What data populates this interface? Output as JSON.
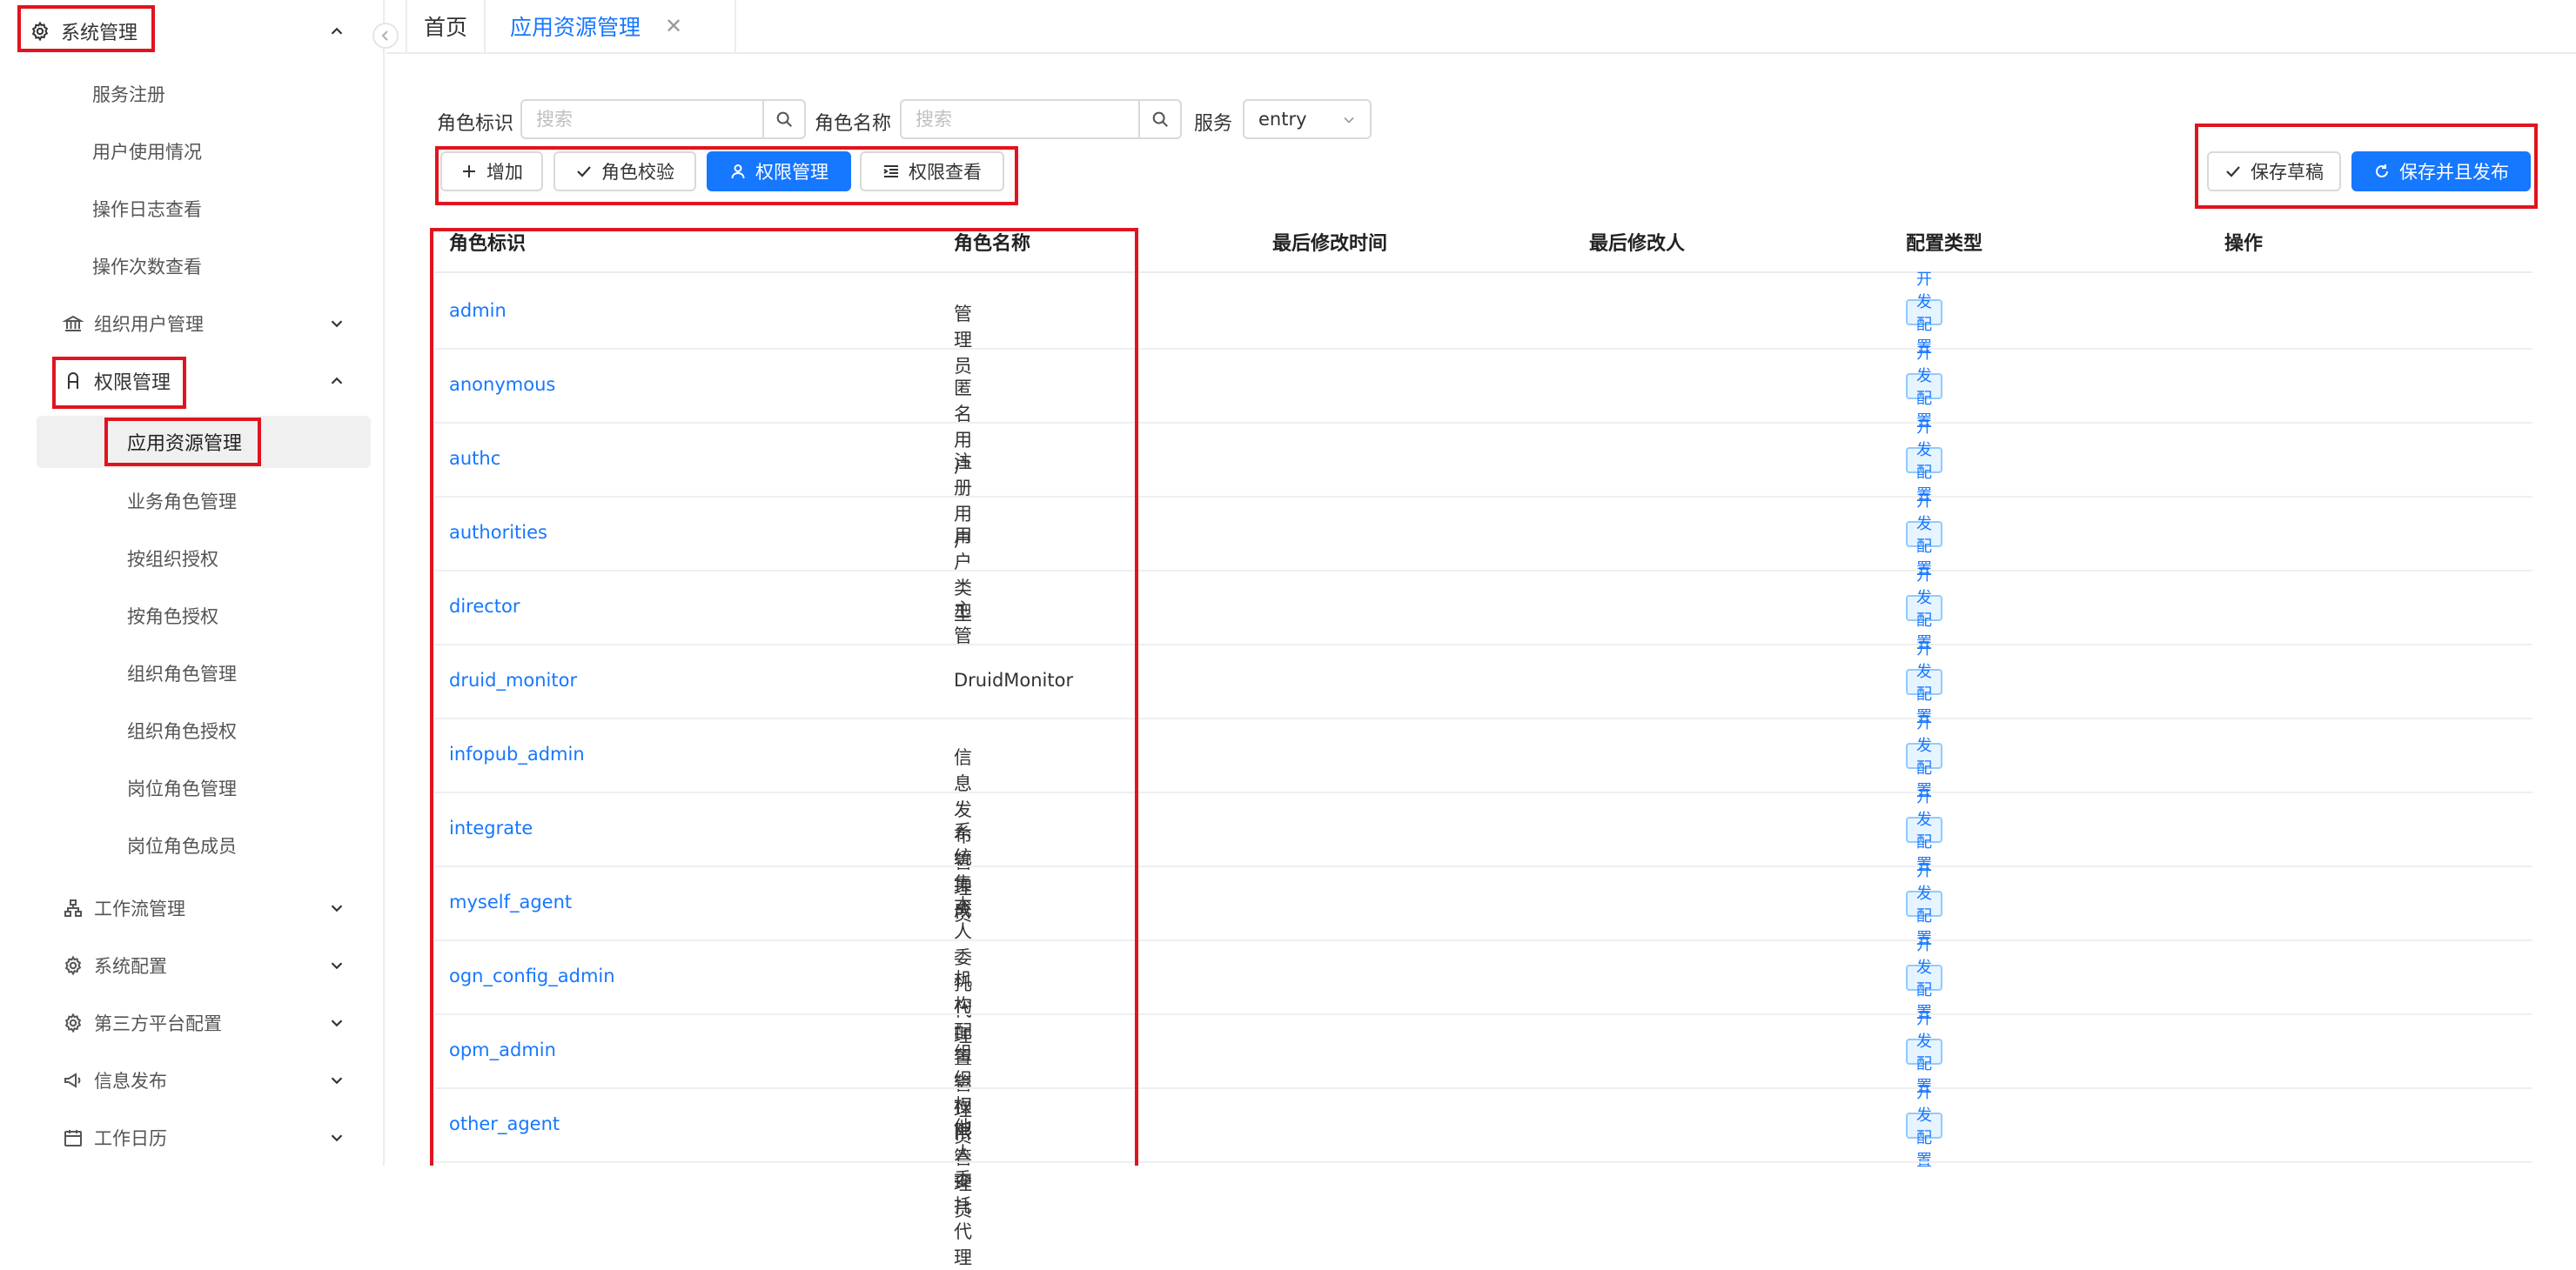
{
  "sidebar": {
    "items": [
      {
        "label": "系统管理",
        "icon": "gear-icon",
        "expanded": true
      },
      {
        "label": "服务注册"
      },
      {
        "label": "用户使用情况"
      },
      {
        "label": "操作日志查看"
      },
      {
        "label": "操作次数查看"
      },
      {
        "label": "组织用户管理",
        "icon": "bank-icon",
        "expanded": false
      },
      {
        "label": "权限管理",
        "icon": "user-lock-icon",
        "expanded": true
      },
      {
        "label": "应用资源管理",
        "active": true
      },
      {
        "label": "业务角色管理"
      },
      {
        "label": "按组织授权"
      },
      {
        "label": "按角色授权"
      },
      {
        "label": "组织角色管理"
      },
      {
        "label": "组织角色授权"
      },
      {
        "label": "岗位角色管理"
      },
      {
        "label": "岗位角色成员"
      },
      {
        "label": "工作流管理",
        "icon": "workflow-icon",
        "expanded": false
      },
      {
        "label": "系统配置",
        "icon": "gear-icon",
        "expanded": false
      },
      {
        "label": "第三方平台配置",
        "icon": "gear-icon",
        "expanded": false
      },
      {
        "label": "信息发布",
        "icon": "megaphone-icon",
        "expanded": false
      },
      {
        "label": "工作日历",
        "icon": "calendar-icon",
        "expanded": false
      }
    ]
  },
  "tabs": {
    "home": "首页",
    "active": "应用资源管理",
    "close": "✕"
  },
  "filters": {
    "role_id_label": "角色标识",
    "role_id_placeholder": "搜索",
    "role_name_label": "角色名称",
    "role_name_placeholder": "搜索",
    "service_label": "服务",
    "service_value": "entry"
  },
  "toolbar": {
    "add": "增加",
    "verify": "角色校验",
    "permission_manage": "权限管理",
    "permission_view": "权限查看",
    "save_draft": "保存草稿",
    "save_publish": "保存并且发布"
  },
  "table": {
    "columns": [
      "角色标识",
      "角色名称",
      "最后修改时间",
      "最后修改人",
      "配置类型",
      "操作"
    ],
    "rows": [
      {
        "id": "admin",
        "name": "管理员",
        "type": "开发配置"
      },
      {
        "id": "anonymous",
        "name": "匿名用户",
        "type": "开发配置"
      },
      {
        "id": "authc",
        "name": "注册用户",
        "type": "开发配置"
      },
      {
        "id": "authorities",
        "name": "用户类型",
        "type": "开发配置"
      },
      {
        "id": "director",
        "name": "主管",
        "type": "开发配置"
      },
      {
        "id": "druid_monitor",
        "name": "DruidMonitor",
        "type": "开发配置"
      },
      {
        "id": "infopub_admin",
        "name": "信息发布管理员",
        "type": "开发配置"
      },
      {
        "id": "integrate",
        "name": "系统集成",
        "type": "开发配置"
      },
      {
        "id": "myself_agent",
        "name": "本人委托代理",
        "type": "开发配置"
      },
      {
        "id": "ogn_config_admin",
        "name": "机构配置管理员",
        "type": "开发配置"
      },
      {
        "id": "opm_admin",
        "name": "组织权限管理员",
        "type": "开发配置"
      },
      {
        "id": "other_agent",
        "name": "他人委托代理",
        "type": "开发配置"
      }
    ]
  },
  "colors": {
    "accent": "#1677ff",
    "highlight_box": "#e0141e",
    "tag_bg": "#e6f4ff",
    "tag_border": "#91caff"
  }
}
